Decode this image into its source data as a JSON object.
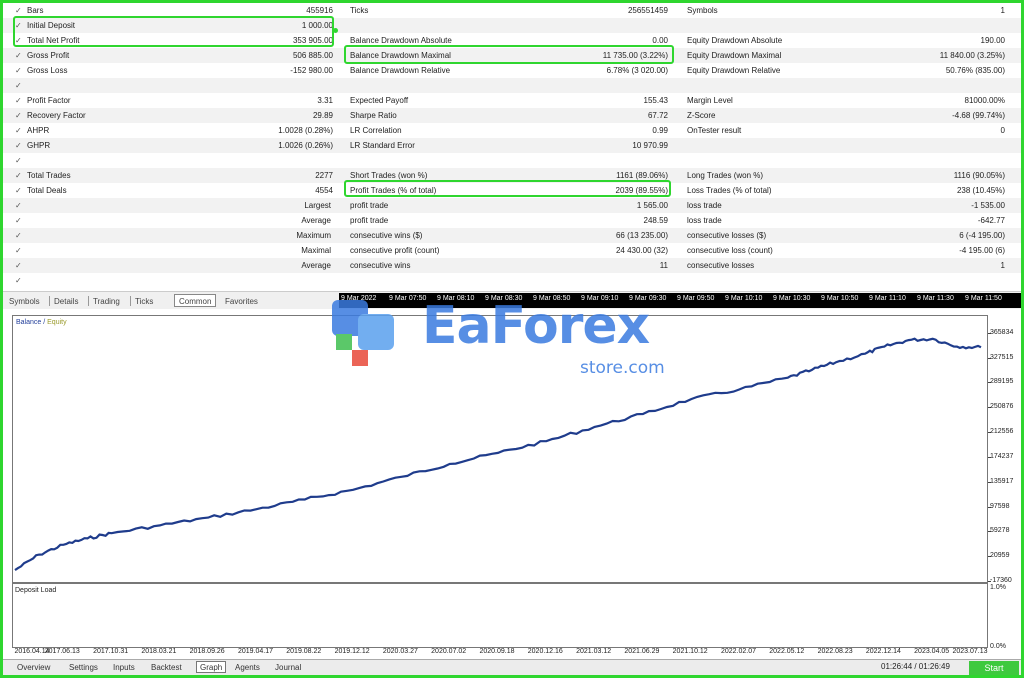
{
  "report": {
    "rows": [
      {
        "c1_label": "Bars",
        "c1_value": "455916",
        "c2_label": "Ticks",
        "c2_value": "256551459",
        "c3_label": "Symbols",
        "c3_value": "1"
      },
      {
        "c1_label": "Initial Deposit",
        "c1_value": "1 000.00",
        "c2_label": "",
        "c2_value": "",
        "c3_label": "",
        "c3_value": ""
      },
      {
        "c1_label": "Total Net Profit",
        "c1_value": "353 905.00",
        "c2_label": "Balance Drawdown Absolute",
        "c2_value": "0.00",
        "c3_label": "Equity Drawdown Absolute",
        "c3_value": "190.00"
      },
      {
        "c1_label": "Gross Profit",
        "c1_value": "506 885.00",
        "c2_label": "Balance Drawdown Maximal",
        "c2_value": "11 735.00 (3.22%)",
        "c3_label": "Equity Drawdown Maximal",
        "c3_value": "11 840.00 (3.25%)"
      },
      {
        "c1_label": "Gross Loss",
        "c1_value": "-152 980.00",
        "c2_label": "Balance Drawdown Relative",
        "c2_value": "6.78% (3 020.00)",
        "c3_label": "Equity Drawdown Relative",
        "c3_value": "50.76% (835.00)"
      },
      {
        "c1_label": "",
        "c1_value": "",
        "c2_label": "",
        "c2_value": "",
        "c3_label": "",
        "c3_value": ""
      },
      {
        "c1_label": "Profit Factor",
        "c1_value": "3.31",
        "c2_label": "Expected Payoff",
        "c2_value": "155.43",
        "c3_label": "Margin Level",
        "c3_value": "81000.00%"
      },
      {
        "c1_label": "Recovery Factor",
        "c1_value": "29.89",
        "c2_label": "Sharpe Ratio",
        "c2_value": "67.72",
        "c3_label": "Z-Score",
        "c3_value": "-4.68 (99.74%)"
      },
      {
        "c1_label": "AHPR",
        "c1_value": "1.0028 (0.28%)",
        "c2_label": "LR Correlation",
        "c2_value": "0.99",
        "c3_label": "OnTester result",
        "c3_value": "0"
      },
      {
        "c1_label": "GHPR",
        "c1_value": "1.0026 (0.26%)",
        "c2_label": "LR Standard Error",
        "c2_value": "10 970.99",
        "c3_label": "",
        "c3_value": ""
      },
      {
        "c1_label": "",
        "c1_value": "",
        "c2_label": "",
        "c2_value": "",
        "c3_label": "",
        "c3_value": ""
      },
      {
        "c1_label": "Total Trades",
        "c1_value": "2277",
        "c2_label": "Short Trades (won %)",
        "c2_value": "1161 (89.06%)",
        "c3_label": "Long Trades (won %)",
        "c3_value": "1116 (90.05%)"
      },
      {
        "c1_label": "Total Deals",
        "c1_value": "4554",
        "c2_label": "Profit Trades (% of total)",
        "c2_value": "2039 (89.55%)",
        "c3_label": "Loss Trades (% of total)",
        "c3_value": "238 (10.45%)"
      },
      {
        "c1_label": "Largest",
        "c1_value": "",
        "c2_label": "profit trade",
        "c2_value": "1 565.00",
        "c3_label": "loss trade",
        "c3_value": "-1 535.00",
        "right_label": true
      },
      {
        "c1_label": "Average",
        "c1_value": "",
        "c2_label": "profit trade",
        "c2_value": "248.59",
        "c3_label": "loss trade",
        "c3_value": "-642.77",
        "right_label": true
      },
      {
        "c1_label": "Maximum",
        "c1_value": "",
        "c2_label": "consecutive wins ($)",
        "c2_value": "66 (13 235.00)",
        "c3_label": "consecutive losses ($)",
        "c3_value": "6 (-4 195.00)",
        "right_label": true
      },
      {
        "c1_label": "Maximal",
        "c1_value": "",
        "c2_label": "consecutive profit (count)",
        "c2_value": "24 430.00 (32)",
        "c3_label": "consecutive loss (count)",
        "c3_value": "-4 195.00 (6)",
        "right_label": true
      },
      {
        "c1_label": "Average",
        "c1_value": "",
        "c2_label": "consecutive wins",
        "c2_value": "11",
        "c3_label": "consecutive losses",
        "c3_value": "1",
        "right_label": true
      },
      {
        "c1_label": "",
        "c1_value": "",
        "c2_label": "",
        "c2_value": "",
        "c3_label": "",
        "c3_value": ""
      }
    ],
    "check_glyph": "✓"
  },
  "top_tabs": [
    "Symbols",
    "Details",
    "Trading",
    "Ticks",
    "Common",
    "Favorites"
  ],
  "active_top_tab": "Common",
  "time_labels": [
    "9 Mar 2022",
    "9 Mar 07:50",
    "9 Mar 08:10",
    "9 Mar 08:30",
    "9 Mar 08:50",
    "9 Mar 09:10",
    "9 Mar 09:30",
    "9 Mar 09:50",
    "9 Mar 10:10",
    "9 Mar 10:30",
    "9 Mar 10:50",
    "9 Mar 11:10",
    "9 Mar 11:30",
    "9 Mar 11:50"
  ],
  "watermark": {
    "brand": "EaForex",
    "sub": "store.com"
  },
  "graph": {
    "legend_balance": "Balance",
    "legend_sep": " / ",
    "legend_equity": "Equity",
    "deposit_title": "Deposit Load",
    "deposit_top": "1.0%",
    "deposit_bottom": "0.0%"
  },
  "chart_data": {
    "type": "line",
    "title": "",
    "xlabel": "",
    "ylabel": "",
    "series": [
      {
        "name": "Balance",
        "color": "#1f3c8c"
      }
    ],
    "y_ticks": [
      365834,
      327515,
      289195,
      250876,
      212556,
      174237,
      135917,
      97598,
      59278,
      20959,
      -17360
    ],
    "ylim": [
      -17360,
      384000
    ],
    "x_ticks": [
      "2016.04.14",
      "2017.06.13",
      "2017.10.31",
      "2018.03.21",
      "2018.09.26",
      "2019.04.17",
      "2019.08.22",
      "2019.12.12",
      "2020.03.27",
      "2020.07.02",
      "2020.09.18",
      "2020.12.16",
      "2021.03.12",
      "2021.06.29",
      "2021.10.12",
      "2022.02.07",
      "2022.05.12",
      "2022.08.23",
      "2022.12.14",
      "2023.04.05",
      "2023.07.13"
    ],
    "points_x_index": [
      0,
      0.5,
      1,
      1.5,
      2,
      3,
      4,
      5,
      6,
      7,
      8,
      9,
      10,
      11,
      12,
      13,
      14,
      15,
      16,
      16.5,
      17,
      17.6,
      18,
      18.5,
      19,
      19.5,
      20
    ],
    "points_y": [
      1000,
      25000,
      40000,
      50000,
      58000,
      70000,
      82000,
      95000,
      110000,
      125000,
      145000,
      165000,
      182000,
      200000,
      222000,
      242000,
      265000,
      280000,
      298000,
      310000,
      322000,
      335000,
      346000,
      356000,
      358000,
      346000,
      345000
    ],
    "grid": false,
    "legend": "top-left"
  },
  "bottom_tabs": [
    "Overview",
    "Settings",
    "Inputs",
    "Backtest",
    "Graph",
    "Agents",
    "Journal"
  ],
  "active_bottom_tab": "Graph",
  "timers": "01:26:44 / 01:26:49",
  "start_label": "Start",
  "colors": {
    "highlight": "#2fd62f",
    "line": "#1f3c8c",
    "start": "#3ec93e"
  }
}
